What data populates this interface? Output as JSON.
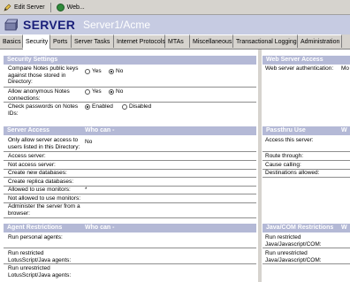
{
  "toolbar": {
    "edit_server": "Edit Server",
    "web": "Web..."
  },
  "header": {
    "title": "SERVER",
    "subtitle": "Server1/Acme"
  },
  "tabs": [
    "Basics",
    "Security",
    "Ports",
    "Server Tasks",
    "Internet Protocols",
    "MTAs",
    "Miscellaneous",
    "Transactional Logging",
    "Administration"
  ],
  "active_tab": "Security",
  "security_settings": {
    "title": "Security Settings",
    "compare_label": "Compare Notes public keys against those stored in Directory:",
    "compare_yes": "Yes",
    "compare_no": "No",
    "anon_label": "Allow anonymous Notes connections:",
    "anon_yes": "Yes",
    "anon_no": "No",
    "check_label": "Check passwords on Notes IDs:",
    "check_enabled": "Enabled",
    "check_disabled": "Disabled"
  },
  "web_server_access": {
    "title": "Web Server Access",
    "auth_label": "Web server authentication:",
    "auth_value": "Mo"
  },
  "server_access": {
    "title": "Server Access",
    "who": "Who can -",
    "only_label": "Only allow server access to users listed in this Directory:",
    "only_value": "No",
    "access": "Access server:",
    "not_access": "Not access server:",
    "create_db": "Create new databases:",
    "create_rep": "Create replica databases:",
    "monitors": "Allowed to use monitors:",
    "monitors_value": "*",
    "not_monitors": "Not allowed to use monitors:",
    "admin": "Administer the server from a browser:"
  },
  "passthru": {
    "title": "Passthru Use",
    "who": "W",
    "access": "Access this server:",
    "route": "Route through:",
    "calling": "Cause calling:",
    "dest": "Destinations allowed:"
  },
  "agent": {
    "title": "Agent Restrictions",
    "who": "Who can -",
    "personal": "Run personal agents:",
    "restricted": "Run restricted LotusScript/Java agents:",
    "unrestricted": "Run unrestricted LotusScript/Java agents:"
  },
  "java": {
    "title": "Java/COM Restrictions",
    "who": "W",
    "restricted": "Run restricted Java/Javascript/COM:",
    "unrestricted": "Run unrestricted Java/Javascript/COM:"
  },
  "colors": {
    "header_bg": "#c6cbe2",
    "section_bg": "#b4b9d6",
    "title": "#1a1f7a"
  }
}
